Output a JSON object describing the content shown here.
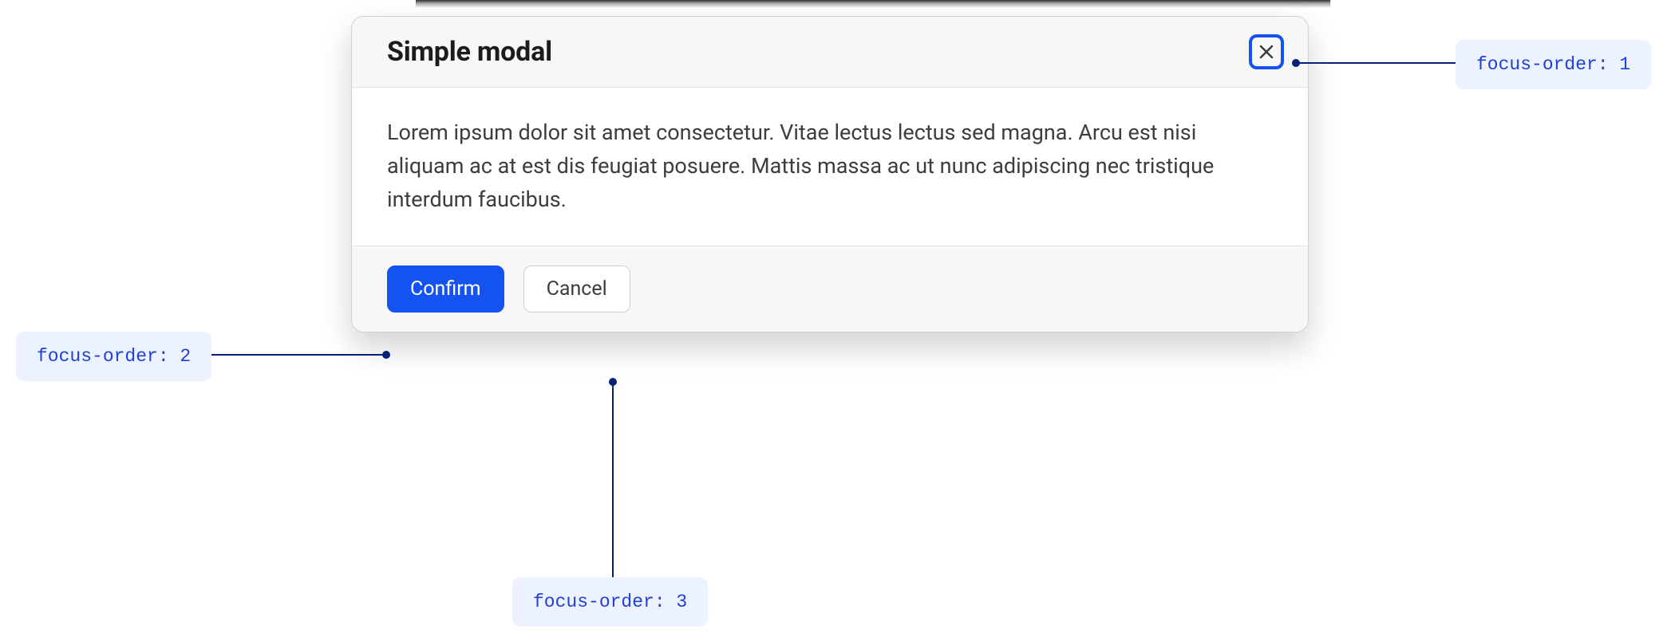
{
  "modal": {
    "title": "Simple modal",
    "body": "Lorem ipsum dolor sit amet consectetur. Vitae lectus lectus sed magna. Arcu est nisi aliquam ac at est dis feugiat posuere. Mattis massa ac ut nunc adipiscing nec tristique interdum faucibus.",
    "confirm_label": "Confirm",
    "cancel_label": "Cancel"
  },
  "annotations": {
    "close": "focus-order: 1",
    "confirm": "focus-order: 2",
    "cancel": "focus-order: 3"
  }
}
